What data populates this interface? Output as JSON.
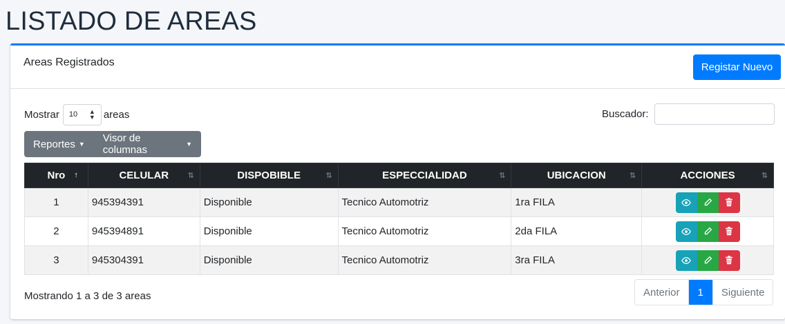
{
  "page": {
    "title": "LISTADO DE AREAS"
  },
  "card": {
    "title": "Areas Registrados",
    "new_button": "Registar Nuevo"
  },
  "length": {
    "prefix": "Mostrar",
    "value": "10",
    "suffix": "areas"
  },
  "search": {
    "label": "Buscador:",
    "value": ""
  },
  "toolbar": {
    "reports": "Reportes",
    "columns": "Visor de columnas"
  },
  "table": {
    "headers": [
      "Nro",
      "CELULAR",
      "DISPOBIBLE",
      "ESPECCIALIDAD",
      "UBICACION",
      "ACCIONES"
    ],
    "rows": [
      {
        "nro": "1",
        "celular": "945394391",
        "disponible": "Disponible",
        "especialidad": "Tecnico Automotriz",
        "ubicacion": "1ra FILA"
      },
      {
        "nro": "2",
        "celular": "945394891",
        "disponible": "Disponible",
        "especialidad": "Tecnico Automotriz",
        "ubicacion": "2da FILA"
      },
      {
        "nro": "3",
        "celular": "945304391",
        "disponible": "Disponible",
        "especialidad": "Tecnico Automotriz",
        "ubicacion": "3ra FILA"
      }
    ]
  },
  "info": "Mostrando 1 a 3 de 3 areas",
  "pagination": {
    "prev": "Anterior",
    "current": "1",
    "next": "Siguiente"
  },
  "icons": {
    "view": "eye-icon",
    "edit": "pencil-icon",
    "delete": "trash-icon"
  },
  "colors": {
    "primary": "#007bff",
    "view": "#17a2b8",
    "edit": "#28a745",
    "delete": "#dc3545",
    "header": "#212529"
  }
}
